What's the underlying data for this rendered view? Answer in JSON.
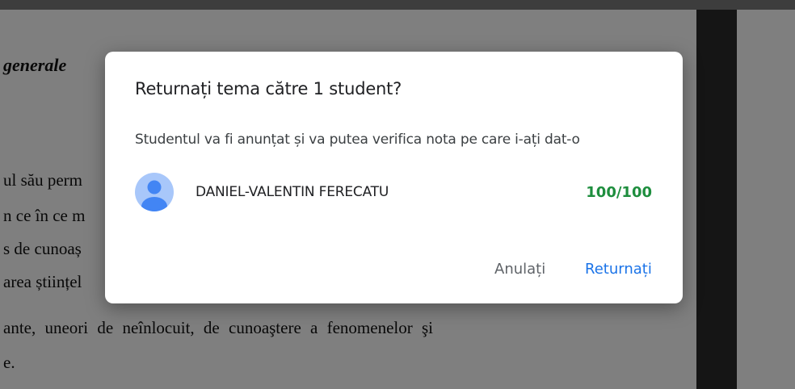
{
  "document": {
    "heading_fragment": "generale",
    "lines": [
      "ul său perm",
      "n ce în ce m",
      "s de cunoaș",
      "area științel",
      "ante, uneori de neînlocuit, de cunoaştere a fenomenelor şi",
      "e."
    ]
  },
  "dialog": {
    "title": "Returnați tema către 1 student?",
    "message": "Studentul va fi anunțat și va putea verifica nota pe care i-ați dat-o",
    "student": {
      "name": "DANIEL-VALENTIN FERECATU",
      "grade": "100/100",
      "avatar_icon": "person-avatar-icon"
    },
    "buttons": {
      "cancel_label": "Anulați",
      "return_label": "Returnați"
    }
  },
  "colors": {
    "accent": "#1a73e8",
    "grade": "#1e8e3e",
    "avatar_bg": "#a8c7fa",
    "avatar_fg": "#4285f4"
  }
}
